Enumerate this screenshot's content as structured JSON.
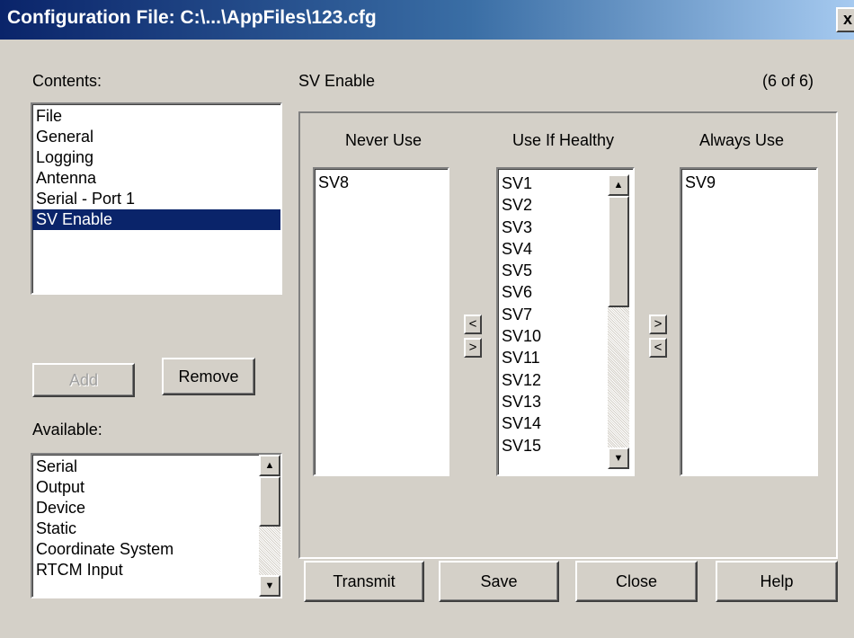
{
  "window": {
    "title": "Configuration File: C:\\...\\AppFiles\\123.cfg",
    "close_glyph": "x"
  },
  "contents": {
    "label": "Contents:",
    "items": [
      "File",
      "General",
      "Logging",
      "Antenna",
      "Serial - Port 1",
      "SV Enable"
    ],
    "selected": "SV Enable"
  },
  "buttons": {
    "add": "Add",
    "remove": "Remove",
    "transmit": "Transmit",
    "save": "Save",
    "close": "Close",
    "help": "Help"
  },
  "available": {
    "label": "Available:",
    "items": [
      "Serial",
      "Output",
      "Device",
      "Static",
      "Coordinate System",
      "RTCM Input"
    ]
  },
  "panel": {
    "title": "SV Enable",
    "page_indicator": "(6 of 6)"
  },
  "sv": {
    "never_use": {
      "header": "Never Use",
      "items": [
        "SV8"
      ]
    },
    "use_if_healthy": {
      "header": "Use If Healthy",
      "items": [
        "SV1",
        "SV2",
        "SV3",
        "SV4",
        "SV5",
        "SV6",
        "SV7",
        "SV10",
        "SV11",
        "SV12",
        "SV13",
        "SV14",
        "SV15"
      ]
    },
    "always_use": {
      "header": "Always Use",
      "items": [
        "SV9"
      ]
    }
  },
  "move_arrows": {
    "left": "<",
    "right": ">"
  },
  "colors": {
    "selection": "#0a246a",
    "dialog_bg": "#d4d0c8"
  }
}
